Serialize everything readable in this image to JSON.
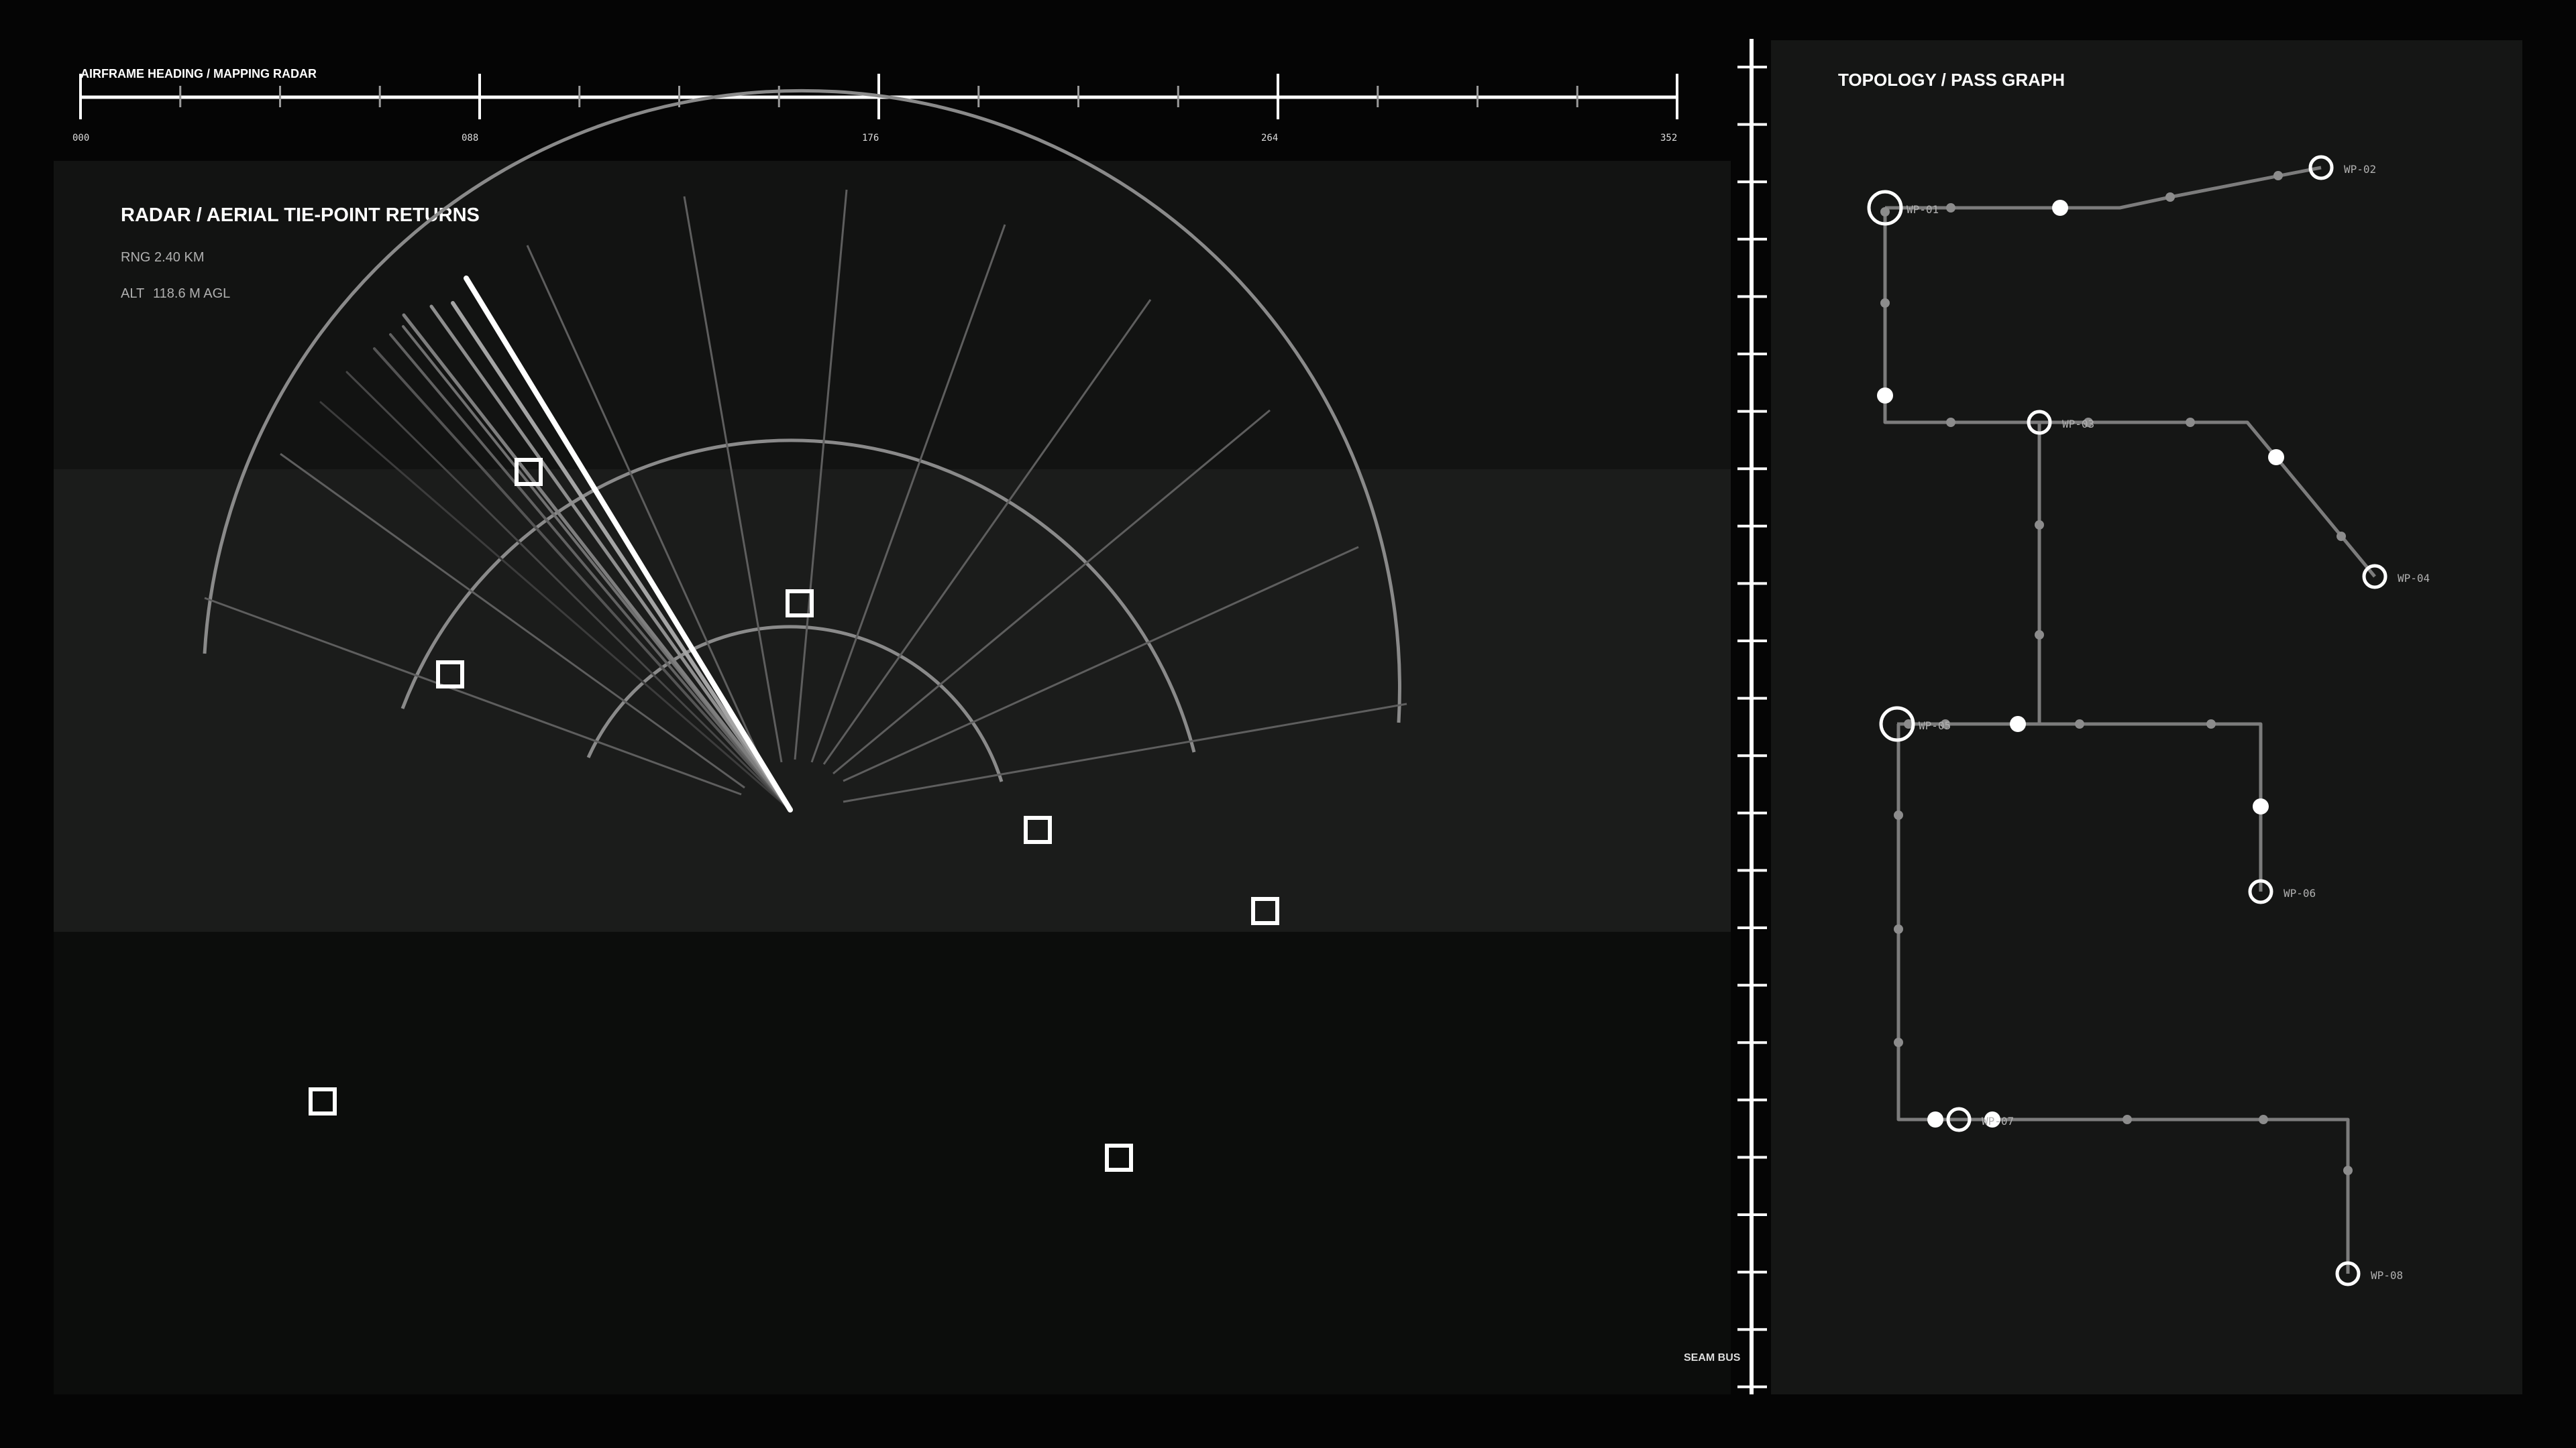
{
  "heading": {
    "title": "AIRFRAME HEADING / MAPPING RADAR",
    "ticks": [
      "000",
      "088",
      "176",
      "264",
      "352"
    ]
  },
  "radar": {
    "title": "RADAR / AERIAL TIE-POINT RETURNS",
    "range_label": "RNG",
    "range_value": "2.40 KM",
    "alt_label": "ALT",
    "alt_value": "118.6 M AGL"
  },
  "seam_bus": {
    "label": "SEAM BUS"
  },
  "topology": {
    "title": "TOPOLOGY / PASS GRAPH",
    "waypoints": [
      {
        "label": "WP-01"
      },
      {
        "label": "WP-02"
      },
      {
        "label": "WP-03"
      },
      {
        "label": "WP-04"
      },
      {
        "label": "WP-05"
      },
      {
        "label": "WP-06"
      },
      {
        "label": "WP-07"
      },
      {
        "label": "WP-08"
      }
    ]
  },
  "colors": {
    "background": "#050505",
    "panel": "#121312",
    "band": "#1b1c1b",
    "lower": "#0c0d0c",
    "accent": "#ffffff",
    "grid": "#7a7a7a"
  }
}
